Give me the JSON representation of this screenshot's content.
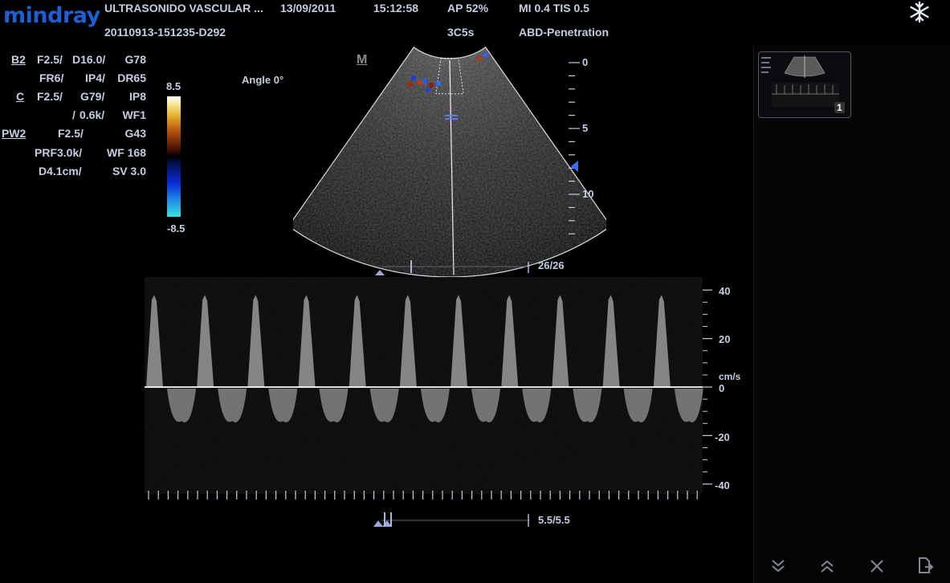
{
  "header": {
    "brand": "mindray",
    "exam_title": "ULTRASONIDO VASCULAR ...",
    "date": "13/09/2011",
    "time": "15:12:58",
    "patient_id": "20110913-151235-D292",
    "ap": "AP  52%",
    "probe": "3C5s",
    "mi_tis": "MI 0.4  TIS 0.5",
    "preset": "ABD-Penetration"
  },
  "params": {
    "b_mode": "B2",
    "b_line1": [
      "F2.5/",
      "D16.0/",
      "G78"
    ],
    "b_line2": [
      "FR6/",
      "IP4/",
      "DR65"
    ],
    "c_mode": "C",
    "c_line1": [
      "F2.5/",
      "G79/",
      "IP8"
    ],
    "c_line2": [
      "/",
      "0.6k/",
      "WF1"
    ],
    "pw_mode": "PW2",
    "pw_line1": [
      "F2.5/",
      "G43"
    ],
    "pw_line2": [
      "PRF3.0k/",
      "WF 168"
    ],
    "pw_line3": [
      "D4.1cm/",
      "SV 3.0"
    ]
  },
  "color_bar": {
    "max": "8.5",
    "min": "-8.5"
  },
  "angle": "Angle 0°",
  "m_marker": "M",
  "depth_scale": {
    "labels": [
      "0",
      "5",
      "10"
    ]
  },
  "cine_counter_top": "26/26",
  "cine_counter_bottom": "5.5/5.5",
  "doppler": {
    "unit": "cm/s",
    "velocity_labels": [
      "40",
      "20",
      "0",
      "-20",
      "-40"
    ],
    "velocity_values": [
      40,
      20,
      0,
      -20,
      -40
    ],
    "peak_systolic_velocity_cm_s": 38,
    "reverse_flow_velocity_cm_s": -14,
    "cycles": 11
  },
  "thumbnail": {
    "index": "1"
  },
  "freeze_icon": "snowflake-icon",
  "bottom_buttons": [
    {
      "name": "page-down-button",
      "icon": "double-chevron-down-icon",
      "glyph": "⌄⌄"
    },
    {
      "name": "page-up-button",
      "icon": "double-chevron-up-icon",
      "glyph": "⌃⌃"
    },
    {
      "name": "delete-button",
      "icon": "close-icon",
      "glyph": "✕"
    },
    {
      "name": "exit-button",
      "icon": "exit-icon",
      "glyph": "⇥"
    }
  ],
  "colors": {
    "brand": "#1f5fd6",
    "text": "#c4cde2",
    "background": "#000000"
  }
}
